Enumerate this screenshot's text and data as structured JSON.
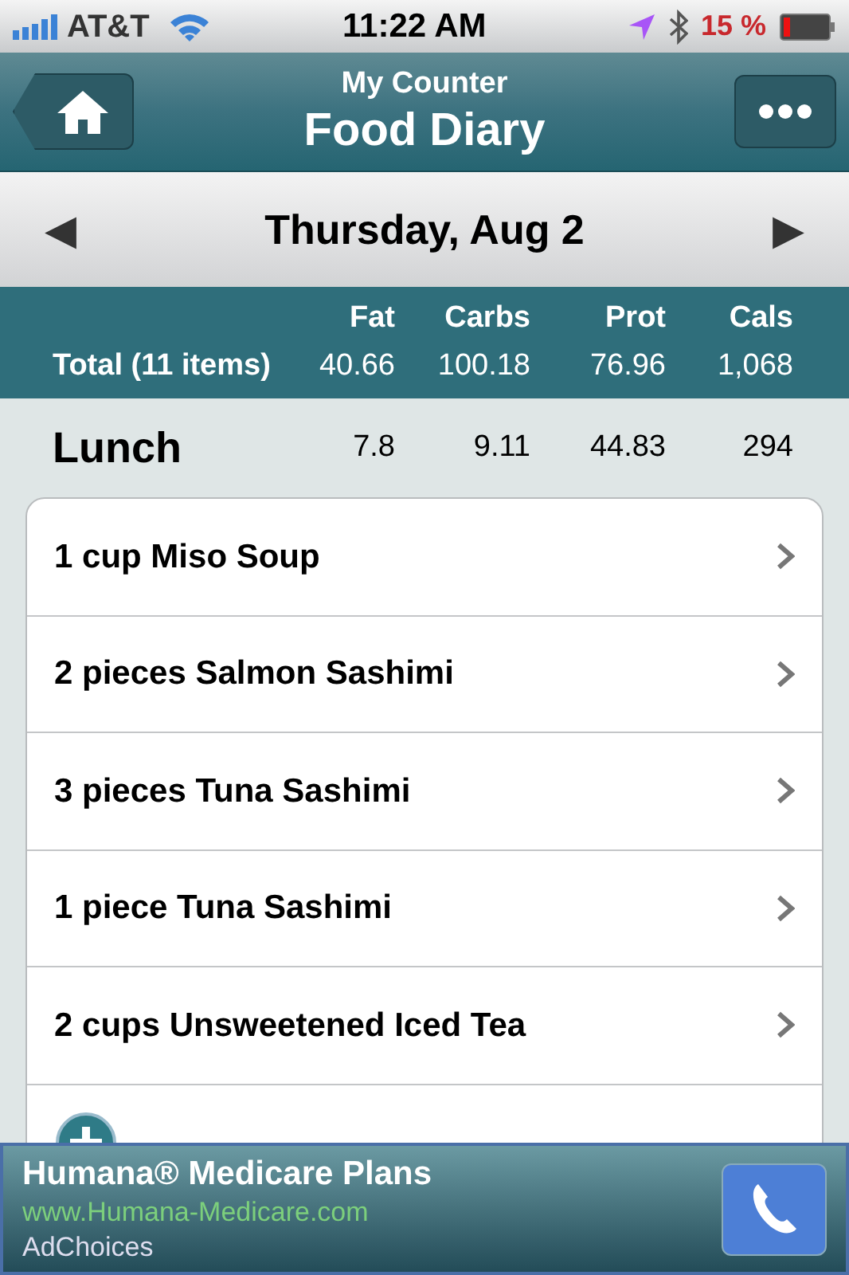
{
  "status_bar": {
    "carrier": "AT&T",
    "time": "11:22 AM",
    "battery": "15 %"
  },
  "nav": {
    "subtitle": "My Counter",
    "title": "Food Diary"
  },
  "date_bar": {
    "date": "Thursday, Aug 2",
    "prev": "◀",
    "next": "▶"
  },
  "totals": {
    "columns": [
      "Fat",
      "Carbs",
      "Prot",
      "Cals"
    ],
    "label": "Total (11 items)",
    "values": [
      "40.66",
      "100.18",
      "76.96",
      "1,068"
    ]
  },
  "meal": {
    "name": "Lunch",
    "values": [
      "7.8",
      "9.11",
      "44.83",
      "294"
    ]
  },
  "items": [
    {
      "name": "1 cup Miso Soup"
    },
    {
      "name": "2 pieces Salmon Sashimi"
    },
    {
      "name": "3 pieces Tuna Sashimi"
    },
    {
      "name": "1 piece Tuna Sashimi"
    },
    {
      "name": "2 cups Unsweetened Iced Tea"
    }
  ],
  "ad": {
    "title": "Humana® Medicare Plans",
    "url": "www.Humana-Medicare.com",
    "choices": "AdChoices"
  }
}
